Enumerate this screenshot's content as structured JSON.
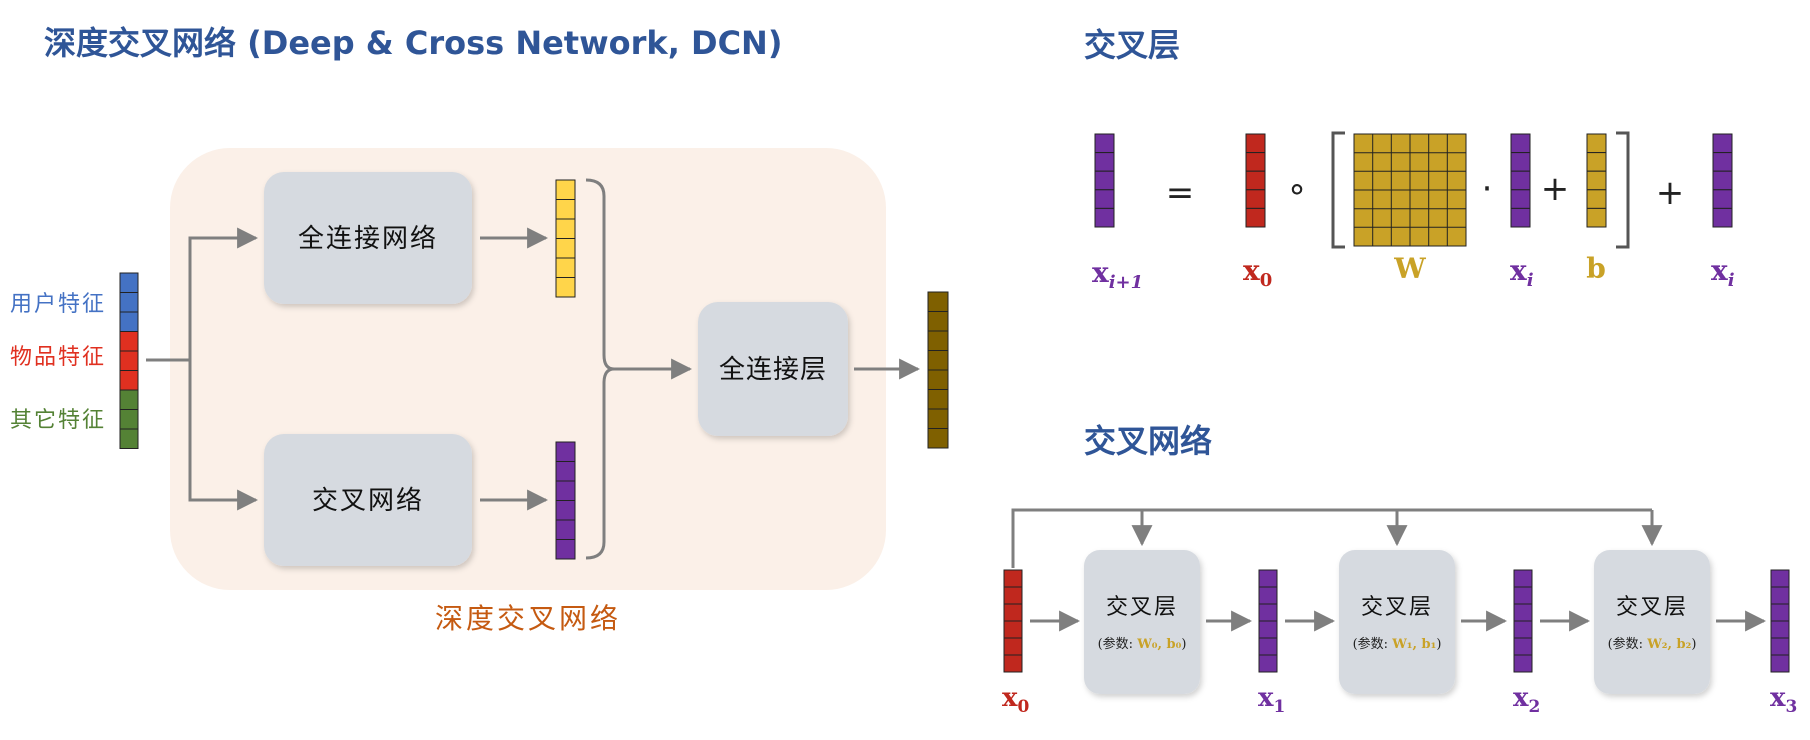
{
  "title_main": "深度交叉网络 (Deep & Cross Network, DCN)",
  "title_cross_layer": "交叉层",
  "title_cross_network": "交叉网络",
  "left": {
    "input_labels": [
      "用户特征",
      "物品特征",
      "其它特征"
    ],
    "fc_network": "全连接网络",
    "cross_network": "交叉网络",
    "fc_layer": "全连接层",
    "region_label": "深度交叉网络"
  },
  "formula": {
    "equals": "=",
    "circ": "∘",
    "dot": "·",
    "plus1": "+",
    "plus2": "+",
    "lhs": "x",
    "lhs_sub": "i+1",
    "x0": "x",
    "x0_sub": "0",
    "W": "W",
    "xi": "x",
    "xi_sub": "i",
    "b": "b",
    "xi2": "x",
    "xi2_sub": "i"
  },
  "network": {
    "layers": [
      {
        "label": "交叉层",
        "param_prefix": "(参数: ",
        "param": "W₀, b₀",
        "param_suffix": ")"
      },
      {
        "label": "交叉层",
        "param_prefix": "(参数: ",
        "param": "W₁, b₁",
        "param_suffix": ")"
      },
      {
        "label": "交叉层",
        "param_prefix": "(参数: ",
        "param": "W₂, b₂",
        "param_suffix": ")"
      }
    ],
    "vectors": [
      {
        "sym": "x",
        "sub": "0"
      },
      {
        "sym": "x",
        "sub": "1"
      },
      {
        "sym": "x",
        "sub": "2"
      },
      {
        "sym": "x",
        "sub": "3"
      }
    ]
  },
  "colors": {
    "title": "#2f5597",
    "user": "#4472c4",
    "item": "#e03020",
    "other": "#548235",
    "yellow": "#ffd54a",
    "purple": "#7030a0",
    "brown": "#7f6000",
    "red": "#c0281e",
    "gold": "#c9a227",
    "box": "#d6dae0",
    "region": "#fbf0e8",
    "region_label": "#c55a11",
    "arrow": "#7f7f7f"
  }
}
